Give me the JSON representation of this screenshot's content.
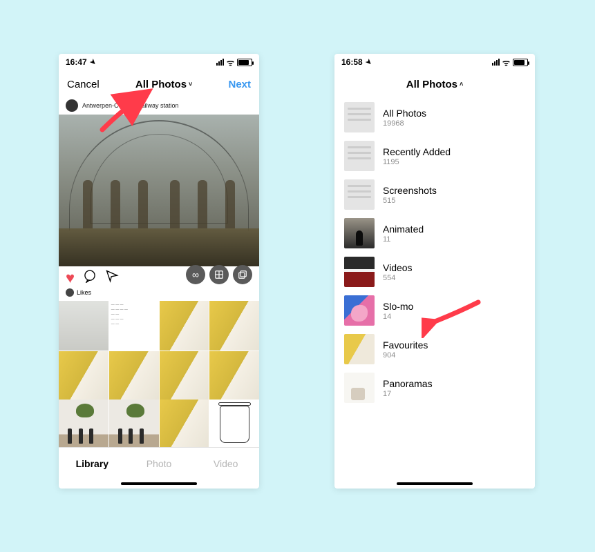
{
  "left": {
    "status_time": "16:47",
    "nav_cancel": "Cancel",
    "nav_title": "All Photos",
    "nav_next": "Next",
    "context_location": "Antwerpen-Centraal railway station",
    "likes_label": "Likes",
    "tabs": {
      "library": "Library",
      "photo": "Photo",
      "video": "Video"
    }
  },
  "right": {
    "status_time": "16:58",
    "nav_title": "All Photos",
    "albums": [
      {
        "name": "All Photos",
        "count": "19968"
      },
      {
        "name": "Recently Added",
        "count": "1195"
      },
      {
        "name": "Screenshots",
        "count": "515"
      },
      {
        "name": "Animated",
        "count": "11"
      },
      {
        "name": "Videos",
        "count": "554"
      },
      {
        "name": "Slo-mo",
        "count": "14"
      },
      {
        "name": "Favourites",
        "count": "904"
      },
      {
        "name": "Panoramas",
        "count": "17"
      }
    ]
  },
  "icons": {
    "infinity": "∞",
    "layout": "▦",
    "multi": "❐",
    "heart": "♥",
    "comment": "◯",
    "send": "▷",
    "bookmark": "⟃",
    "chev_down": "˅",
    "chev_up": "˄",
    "wifi": "ᯤ",
    "loc": "➤"
  }
}
